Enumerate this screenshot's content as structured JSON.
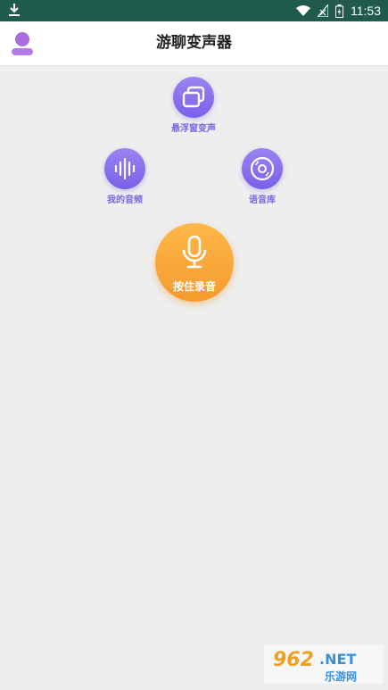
{
  "status_bar": {
    "time": "11:53"
  },
  "app_bar": {
    "title": "游聊变声器"
  },
  "features": {
    "floating": {
      "label": "悬浮窗变声"
    },
    "my_audio": {
      "label": "我的音频"
    },
    "voice_library": {
      "label": "语音库"
    }
  },
  "record_button": {
    "label": "按住录音"
  },
  "watermark": {
    "brand": "962.NET",
    "site": "乐游网"
  },
  "colors": {
    "accent_purple": "#7a60e8",
    "accent_orange": "#f59a2d",
    "status_bar": "#1f5a4c",
    "background": "#eeeeee"
  }
}
